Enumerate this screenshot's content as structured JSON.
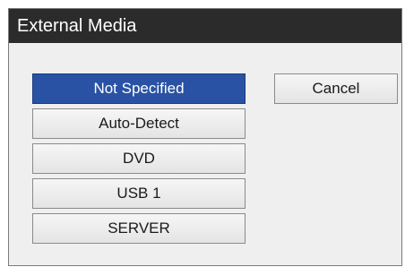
{
  "dialog": {
    "title": "External Media",
    "options": [
      {
        "label": "Not Specified",
        "selected": true
      },
      {
        "label": "Auto-Detect",
        "selected": false
      },
      {
        "label": "DVD",
        "selected": false
      },
      {
        "label": "USB 1",
        "selected": false
      },
      {
        "label": "SERVER",
        "selected": false
      }
    ],
    "cancel_label": "Cancel"
  },
  "colors": {
    "titlebar": "#2b2b2b",
    "selected": "#2a52a4",
    "panel": "#efefef"
  }
}
